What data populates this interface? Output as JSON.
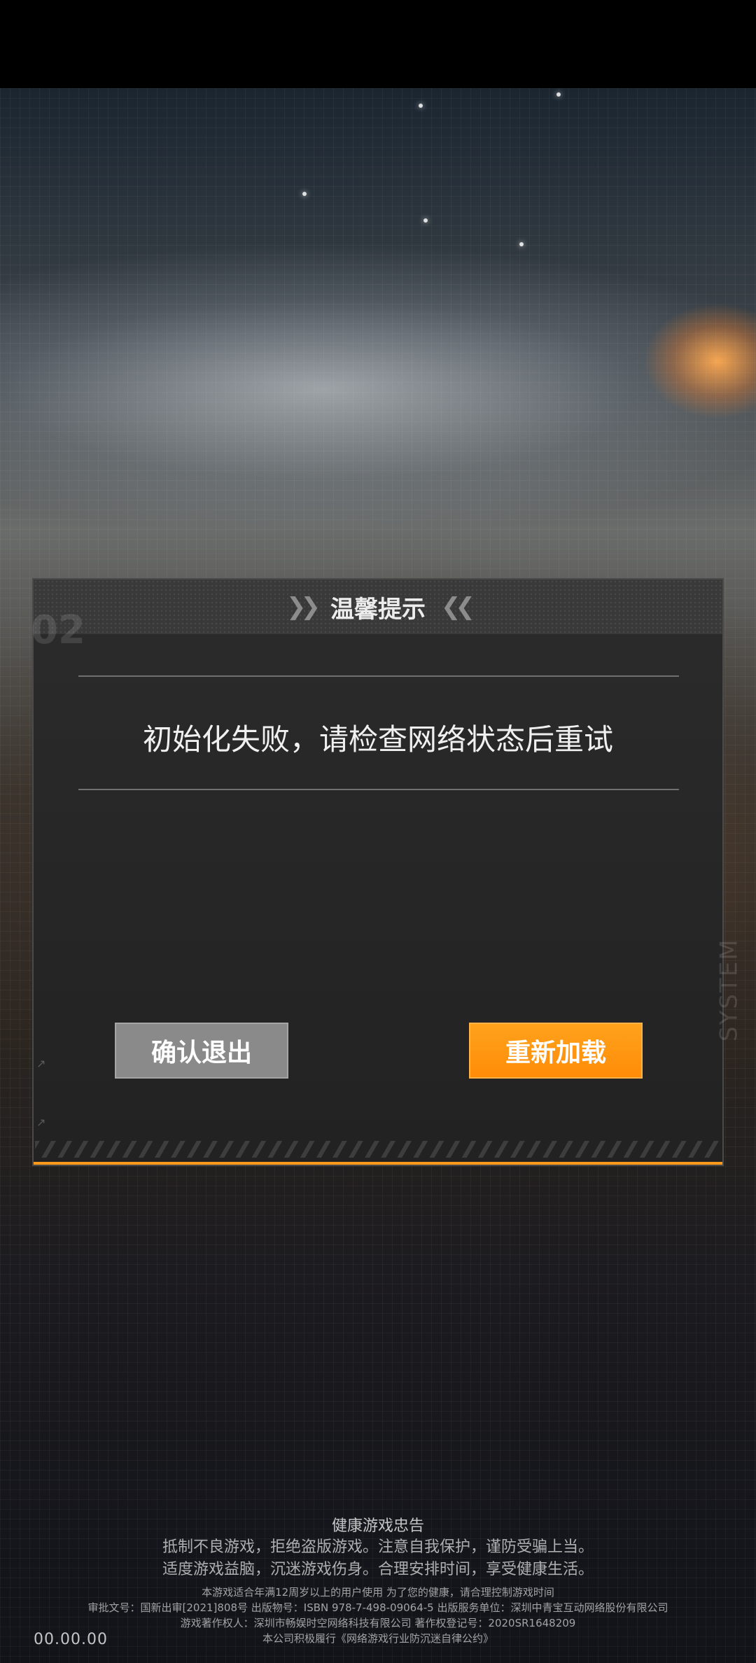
{
  "dialog": {
    "title": "温馨提示",
    "deco_number": "02",
    "message": "初始化失败，请检查网络状态后重试",
    "exit_button": "确认退出",
    "reload_button": "重新加载",
    "side_label": "SYSTEM"
  },
  "notice": {
    "title": "健康游戏忠告",
    "lines": [
      "抵制不良游戏，拒绝盗版游戏。注意自我保护，谨防受骗上当。",
      "适度游戏益脑，沉迷游戏伤身。合理安排时间，享受健康生活。"
    ],
    "small_lines": [
      "本游戏适合年满12周岁以上的用户使用 为了您的健康，请合理控制游戏时间",
      "审批文号：国新出审[2021]808号 出版物号：ISBN 978-7-498-09064-5 出版服务单位：深圳中青宝互动网络股份有限公司",
      "游戏著作权人：深圳市畅娱时空网络科技有限公司 著作权登记号：2020SR1648209",
      "本公司积极履行《网络游戏行业防沉迷自律公约》"
    ]
  },
  "version": "00.00.00",
  "colors": {
    "accent": "#ff9a1a",
    "exit_button": "#8a8a8a"
  }
}
